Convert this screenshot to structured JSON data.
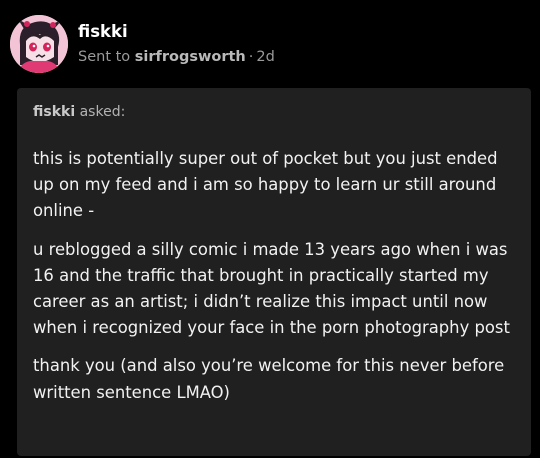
{
  "post": {
    "blog_name": "fiskki",
    "sent_prefix": "Sent to",
    "recipient": "sirfrogsworth",
    "separator": "·",
    "age": "2d"
  },
  "ask": {
    "asker": "fiskki",
    "asked_suffix": "asked:",
    "paragraphs": [
      "this is potentially super out of pocket but you just ended\nup on my feed and i am so happy to learn ur still around\nonline -",
      "u reblogged a silly comic i made 13 years ago when i was\n16 and the traffic that brought in practically started my\ncareer as an artist; i didn’t realize this impact until now\nwhen i recognized your face in the porn photography post",
      "thank you (and also you’re welcome for this never before\nwritten sentence LMAO)"
    ]
  },
  "colors": {
    "background": "#000000",
    "ask_box": "#202020",
    "muted_text": "#9a9a9a",
    "avatar_bg": "#f2c4d6"
  },
  "icons": {
    "avatar": "avatar-illustration"
  }
}
